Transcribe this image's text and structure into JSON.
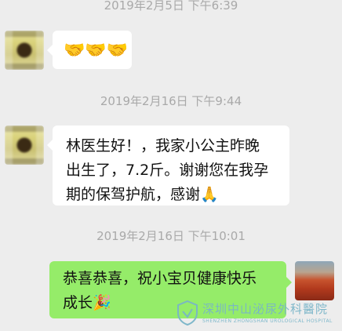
{
  "messages": [
    {
      "timestamp": "2019年2月5日 下午6:39",
      "side": "left",
      "text": "🤝🤝🤝"
    },
    {
      "timestamp": "2019年2月16日 下午9:44",
      "side": "left",
      "lines": [
        "林医生好！，我家小公主昨晚",
        "出生了，7.2斤。谢谢您在我孕",
        "期的保驾护航，感谢🙏"
      ]
    },
    {
      "timestamp": "2019年2月16日 下午10:01",
      "side": "right",
      "lines": [
        "恭喜恭喜，祝小宝贝健康快乐",
        "成长🎉"
      ]
    }
  ],
  "icons": {
    "handshake": "🤝",
    "pray": "🙏",
    "party": "🎉"
  },
  "watermark": {
    "name": "深圳中山泌尿外科醫院",
    "sub": "SHENZHEN ZHONGSHAN UROLOGICAL HOSPITAL"
  },
  "colors": {
    "background": "#ededed",
    "received_bubble": "#ffffff",
    "sent_bubble": "#95ec69",
    "timestamp": "#a9a9a9"
  }
}
